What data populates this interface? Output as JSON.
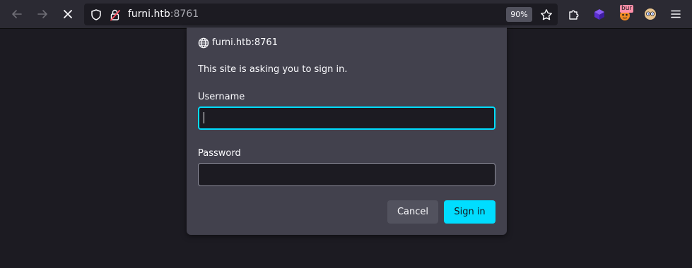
{
  "browser": {
    "url_host": "furni.htb",
    "url_port": ":8761",
    "zoom": "90%",
    "extension_badge": "bur",
    "accent_color": "#00ddff"
  },
  "icons": {
    "back": "arrow-left-icon",
    "forward": "arrow-right-icon",
    "stop": "close-icon",
    "tracking": "shield-icon",
    "lock": "lock-warning-icon",
    "bookmark": "star-icon",
    "extensions": "puzzle-icon",
    "menu": "hamburger-menu-icon",
    "origin": "globe-icon"
  },
  "dialog": {
    "origin": "furni.htb:8761",
    "message": "This site is asking you to sign in.",
    "username_label": "Username",
    "username_value": "",
    "password_label": "Password",
    "password_value": "",
    "cancel_label": "Cancel",
    "signin_label": "Sign in"
  }
}
